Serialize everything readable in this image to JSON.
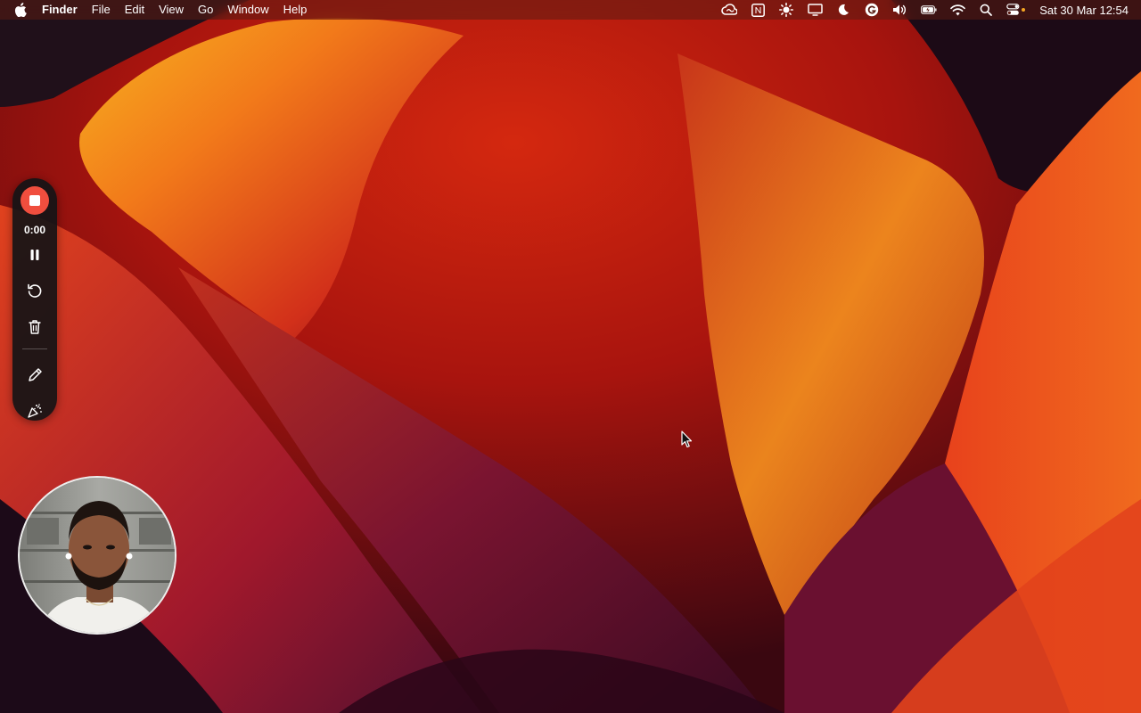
{
  "menubar": {
    "apple_icon": "apple-logo-icon",
    "app_name": "Finder",
    "menus": [
      "File",
      "Edit",
      "View",
      "Go",
      "Window",
      "Help"
    ],
    "status_icons": [
      "creative-cloud-icon",
      "notion-icon",
      "brightness-icon",
      "display-icon",
      "moon-icon",
      "grammarly-icon",
      "volume-icon",
      "battery-icon",
      "wifi-icon",
      "spotlight-search-icon",
      "control-center-icon"
    ],
    "clock": "Sat 30 Mar  12:54"
  },
  "recorder": {
    "timer": "0:00",
    "buttons": [
      "stop-icon",
      "pause-icon",
      "restart-icon",
      "trash-icon",
      "pencil-icon",
      "effects-icon"
    ],
    "stop_color": "#f04e3e"
  },
  "webcam": {
    "description_icon": "webcam-person-icon"
  },
  "colors": {
    "accent_orange": "#f07a1a",
    "accent_red": "#c0201a",
    "dark_bg": "#1a0610"
  }
}
